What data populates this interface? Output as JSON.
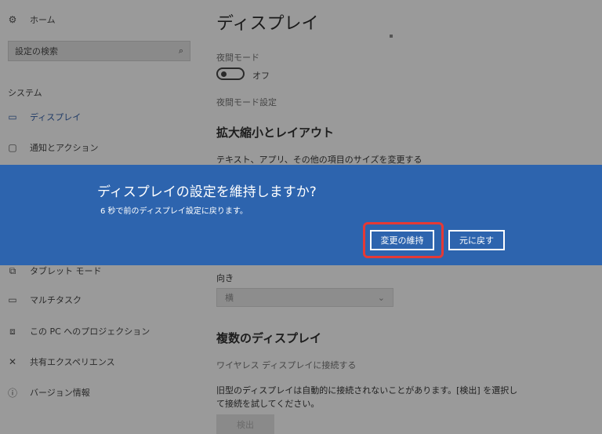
{
  "sidebar": {
    "home": {
      "label": "ホーム",
      "icon": "home-gear-icon"
    },
    "search": {
      "placeholder": "設定の検索",
      "icon": "search-icon"
    },
    "section_label": "システム",
    "items": [
      {
        "label": "ディスプレイ",
        "icon": "monitor-icon"
      },
      {
        "label": "通知とアクション",
        "icon": "notification-icon"
      },
      {
        "label": "タブレット モード",
        "icon": "tablet-mode-icon"
      },
      {
        "label": "マルチタスク",
        "icon": "multitask-icon"
      },
      {
        "label": "この PC へのプロジェクション",
        "icon": "projection-icon"
      },
      {
        "label": "共有エクスペリエンス",
        "icon": "shared-experience-icon"
      },
      {
        "label": "バージョン情報",
        "icon": "info-icon"
      }
    ]
  },
  "main": {
    "title": "ディスプレイ",
    "night_mode": {
      "label": "夜間モード",
      "state": "オフ",
      "settings_link": "夜間モード設定"
    },
    "scale_layout": {
      "heading": "拡大縮小とレイアウト",
      "description": "テキスト、アプリ、その他の項目のサイズを変更する"
    },
    "orientation": {
      "label": "向き",
      "value": "横"
    },
    "multiple_displays": {
      "heading": "複数のディスプレイ",
      "wireless_link": "ワイヤレス ディスプレイに接続する",
      "description_line1": "旧型のディスプレイは自動的に接続されないことがあります。[検出] を選択し",
      "description_line2": "て接続を試してください。",
      "detect_button": "検出"
    }
  },
  "dialog": {
    "title": "ディスプレイの設定を維持しますか?",
    "message": "6 秒で前のディスプレイ設定に戻ります。",
    "keep_button": "変更の維持",
    "revert_button": "元に戻す",
    "background_color": "#2d64ae",
    "highlight_color": "#e53935"
  }
}
